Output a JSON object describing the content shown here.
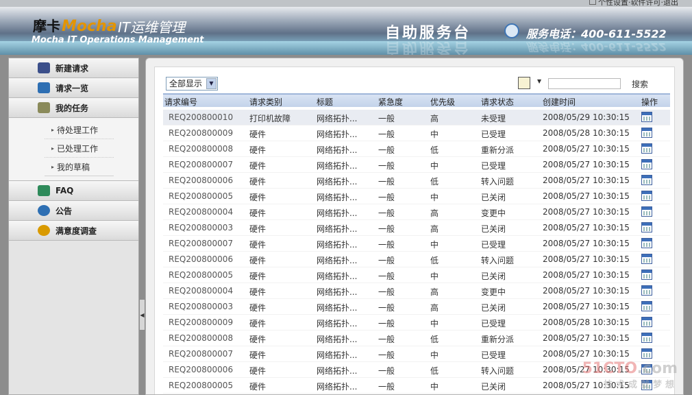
{
  "toplinks": {
    "text": "个性设置·软件许可·退出"
  },
  "header": {
    "logo_cn": "摩卡",
    "logo_brand": "Mocha",
    "logo_sub": "IT运维管理",
    "logo_en": "Mocha IT Operations Management",
    "service_title": "自助服务台",
    "phone_label": "服务电话：400-611-5522"
  },
  "sidebar": {
    "menus": [
      {
        "label": "新建请求",
        "icon": "new-request-icon",
        "color": "#3b4f8a"
      },
      {
        "label": "请求一览",
        "icon": "request-list-icon",
        "color": "#2e6fb3"
      },
      {
        "label": "我的任务",
        "icon": "my-task-icon",
        "color": "#8a8a5a"
      }
    ],
    "task_items": [
      {
        "label": "待处理工作"
      },
      {
        "label": "已处理工作"
      },
      {
        "label": "我的草稿"
      }
    ],
    "menus2": [
      {
        "label": "FAQ",
        "icon": "faq-icon",
        "color": "#2e8a5a"
      },
      {
        "label": "公告",
        "icon": "announcement-icon",
        "color": "#2e6fb3"
      },
      {
        "label": "满意度调查",
        "icon": "survey-icon",
        "color": "#d99a00"
      }
    ]
  },
  "toolbar": {
    "filter_value": "全部显示",
    "search_label": "搜索"
  },
  "table": {
    "headers": [
      "请求编号",
      "请求类别",
      "标题",
      "紧急度",
      "优先级",
      "请求状态",
      "创建时间",
      "操作"
    ],
    "rows": [
      {
        "id": "REQ200800010",
        "category": "打印机故障",
        "title": "网络拓扑...",
        "urgency": "一般",
        "priority": "高",
        "status": "未受理",
        "created": "2008/05/29 10:30:15"
      },
      {
        "id": "REQ200800009",
        "category": "硬件",
        "title": "网络拓扑...",
        "urgency": "一般",
        "priority": "中",
        "status": "已受理",
        "created": "2008/05/28 10:30:15"
      },
      {
        "id": "REQ200800008",
        "category": "硬件",
        "title": "网络拓扑...",
        "urgency": "一般",
        "priority": "低",
        "status": "重新分派",
        "created": "2008/05/27 10:30:15"
      },
      {
        "id": "REQ200800007",
        "category": "硬件",
        "title": "网络拓扑...",
        "urgency": "一般",
        "priority": "中",
        "status": "已受理",
        "created": "2008/05/27 10:30:15"
      },
      {
        "id": "REQ200800006",
        "category": "硬件",
        "title": "网络拓扑...",
        "urgency": "一般",
        "priority": "低",
        "status": "转入问题",
        "created": "2008/05/27 10:30:15"
      },
      {
        "id": "REQ200800005",
        "category": "硬件",
        "title": "网络拓扑...",
        "urgency": "一般",
        "priority": "中",
        "status": "已关闭",
        "created": "2008/05/27 10:30:15"
      },
      {
        "id": "REQ200800004",
        "category": "硬件",
        "title": "网络拓扑...",
        "urgency": "一般",
        "priority": "高",
        "status": "变更中",
        "created": "2008/05/27 10:30:15"
      },
      {
        "id": "REQ200800003",
        "category": "硬件",
        "title": "网络拓扑...",
        "urgency": "一般",
        "priority": "高",
        "status": "已关闭",
        "created": "2008/05/27 10:30:15"
      },
      {
        "id": "REQ200800007",
        "category": "硬件",
        "title": "网络拓扑...",
        "urgency": "一般",
        "priority": "中",
        "status": "已受理",
        "created": "2008/05/27 10:30:15"
      },
      {
        "id": "REQ200800006",
        "category": "硬件",
        "title": "网络拓扑...",
        "urgency": "一般",
        "priority": "低",
        "status": "转入问题",
        "created": "2008/05/27 10:30:15"
      },
      {
        "id": "REQ200800005",
        "category": "硬件",
        "title": "网络拓扑...",
        "urgency": "一般",
        "priority": "中",
        "status": "已关闭",
        "created": "2008/05/27 10:30:15"
      },
      {
        "id": "REQ200800004",
        "category": "硬件",
        "title": "网络拓扑...",
        "urgency": "一般",
        "priority": "高",
        "status": "变更中",
        "created": "2008/05/27 10:30:15"
      },
      {
        "id": "REQ200800003",
        "category": "硬件",
        "title": "网络拓扑...",
        "urgency": "一般",
        "priority": "高",
        "status": "已关闭",
        "created": "2008/05/27 10:30:15"
      },
      {
        "id": "REQ200800009",
        "category": "硬件",
        "title": "网络拓扑...",
        "urgency": "一般",
        "priority": "中",
        "status": "已受理",
        "created": "2008/05/28 10:30:15"
      },
      {
        "id": "REQ200800008",
        "category": "硬件",
        "title": "网络拓扑...",
        "urgency": "一般",
        "priority": "低",
        "status": "重新分派",
        "created": "2008/05/27 10:30:15"
      },
      {
        "id": "REQ200800007",
        "category": "硬件",
        "title": "网络拓扑...",
        "urgency": "一般",
        "priority": "中",
        "status": "已受理",
        "created": "2008/05/27 10:30:15"
      },
      {
        "id": "REQ200800006",
        "category": "硬件",
        "title": "网络拓扑...",
        "urgency": "一般",
        "priority": "低",
        "status": "转入问题",
        "created": "2008/05/27 10:30:15"
      },
      {
        "id": "REQ200800005",
        "category": "硬件",
        "title": "网络拓扑...",
        "urgency": "一般",
        "priority": "中",
        "status": "已关闭",
        "created": "2008/05/27 10:30:15"
      }
    ]
  },
  "watermark": {
    "line1a": "51",
    "line1b": "CTO",
    "line1c": ".com",
    "line2": "技术成就梦想"
  }
}
